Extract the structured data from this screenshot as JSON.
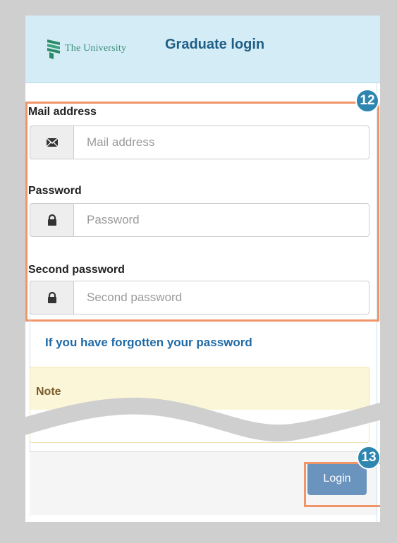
{
  "header": {
    "logo_text": "The University",
    "title": "Graduate login"
  },
  "form": {
    "mail": {
      "label": "Mail address",
      "placeholder": "Mail address",
      "icon": "envelope-icon"
    },
    "password": {
      "label": "Password",
      "placeholder": "Password",
      "icon": "lock-icon"
    },
    "second_password": {
      "label": "Second password",
      "placeholder": "Second password",
      "icon": "lock-icon"
    }
  },
  "forgot_link": "If you have forgotten your password",
  "note": {
    "title": "Note"
  },
  "actions": {
    "login_label": "Login"
  },
  "annotations": {
    "fields_badge": "12",
    "login_badge": "13"
  },
  "colors": {
    "accent": "#2e86b0",
    "highlight": "#f0956a",
    "button": "#6a93bd",
    "header_bg": "#d4ecf6"
  }
}
